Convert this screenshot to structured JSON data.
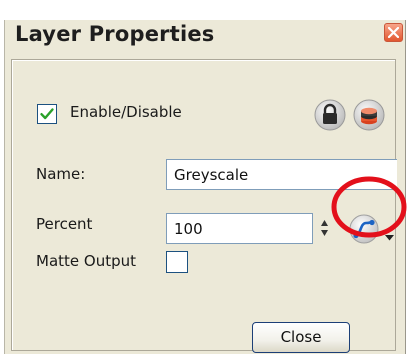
{
  "window": {
    "title": "Layer Properties"
  },
  "enable": {
    "label": "Enable/Disable",
    "checked": true
  },
  "icons": {
    "close": "close-icon",
    "lock": "lock-icon",
    "layer_stack": "layer-stack-icon",
    "spinner": "spinner-arrows-icon",
    "function_curve": "function-curve-icon",
    "dropdown": "dropdown-arrow-icon",
    "checkmark": "checkmark-icon"
  },
  "name": {
    "label": "Name:",
    "value": "Greyscale"
  },
  "percent": {
    "label": "Percent",
    "value": "100"
  },
  "matte": {
    "label": "Matte Output",
    "checked": false
  },
  "buttons": {
    "close_label": "Close"
  },
  "colors": {
    "background": "#ece9d8",
    "highlight_circle": "#e3101b",
    "close_button_red": "#e2572f",
    "check_green": "#2aa12a"
  }
}
